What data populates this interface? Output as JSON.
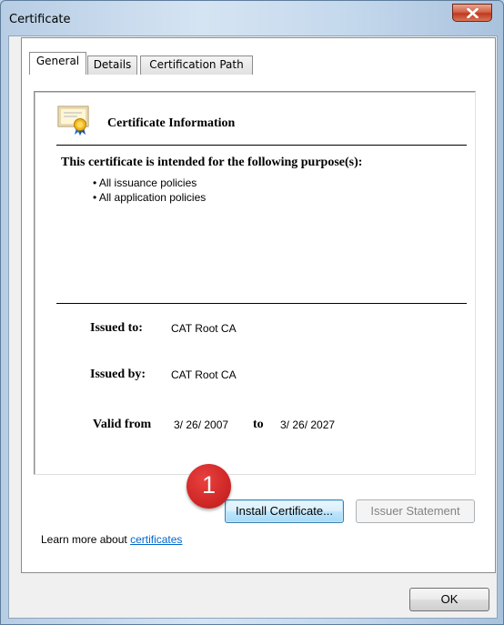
{
  "window": {
    "title": "Certificate"
  },
  "tabs": [
    {
      "label": "General",
      "active": true
    },
    {
      "label": "Details",
      "active": false
    },
    {
      "label": "Certification Path",
      "active": false
    }
  ],
  "cert_info": {
    "heading": "Certificate Information",
    "purpose_heading": "This certificate is intended for the following purpose(s):",
    "purposes": [
      "• All issuance policies",
      "• All application policies"
    ],
    "issued_to_label": "Issued to:",
    "issued_to_value": "CAT Root CA",
    "issued_by_label": "Issued by:",
    "issued_by_value": "CAT Root CA",
    "valid_from_label": "Valid from",
    "valid_from_value": "3/ 26/ 2007",
    "valid_to_label": "to",
    "valid_to_value": "3/ 26/ 2027"
  },
  "buttons": {
    "install": "Install Certificate...",
    "issuer_statement": "Issuer Statement",
    "ok": "OK"
  },
  "learn_more": {
    "prefix": "Learn more about",
    "link": "certificates"
  },
  "annotation": {
    "step": "1"
  },
  "colors": {
    "link": "#0066cc",
    "annotation": "#cf2827",
    "close_button": "#c2381d"
  },
  "icons": {
    "certificate": "certificate-icon",
    "close": "close-icon"
  }
}
